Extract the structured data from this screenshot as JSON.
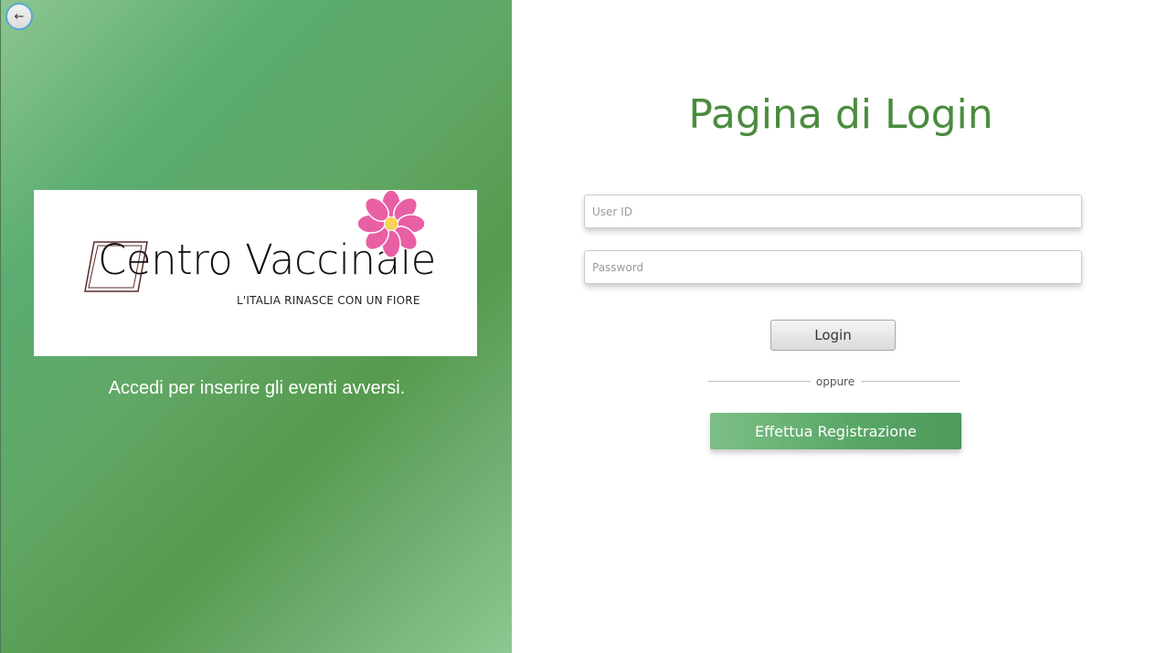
{
  "left_panel": {
    "back_button": {
      "icon": "←",
      "icon_name": "back-arrow-icon"
    },
    "logo": {
      "title": "Centro Vaccinale",
      "tagline": "L'ITALIA RINASCE CON UN FIORE"
    },
    "subtitle": "Accedi per inserire gli eventi avversi."
  },
  "login_form": {
    "title": "Pagina di Login",
    "user_id": {
      "placeholder": "User ID",
      "value": ""
    },
    "password": {
      "placeholder": "Password",
      "value": ""
    },
    "login_label": "Login",
    "divider_text": "oppure",
    "register_label": "Effettua Registrazione"
  },
  "colors": {
    "title_green": "#4a8c3e",
    "panel_green": "#5aac70",
    "flower_pink": "#e95fa4",
    "flower_center": "#f7d358"
  }
}
